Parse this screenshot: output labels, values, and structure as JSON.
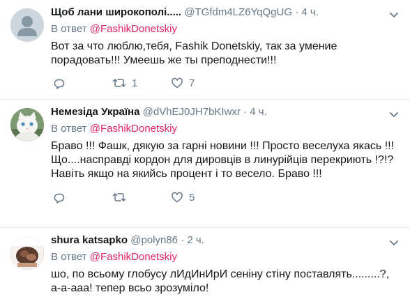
{
  "tweets": [
    {
      "name": "Щоб лани широкополі.....",
      "handle": "@TGfdm4LZ6YqQgUG",
      "sep": "·",
      "time": "4 ч.",
      "reply_prefix": "В ответ",
      "reply_mention": "@FashikDonetskiy",
      "text": "Вот за что люблю,тебя, Fashik Donetskiy, так за умение порадовать!!! Умеешь же ты  преподнести!!!",
      "retweets": "1",
      "likes": "7",
      "avatar": "default-avatar"
    },
    {
      "name": "Немезіда Україна",
      "handle": "@dVhEJ0JH7bKIwxr",
      "sep": "·",
      "time": "4 ч.",
      "reply_prefix": "В ответ",
      "reply_mention": "@FashikDonetskiy",
      "text": "Браво !!! Фашк, дякую за гарні новини !!! Просто веселуха якась !!! Що....насправді кордон для дировців в линурійців перекриють !?!? Навіть якщо на якийсь процент і то весело. Браво !!!",
      "retweets": "",
      "likes": "5",
      "avatar": "white-cat-avatar"
    },
    {
      "name": "shura katsapko",
      "handle": "@polyn86",
      "sep": "·",
      "time": "2 ч.",
      "reply_prefix": "В ответ",
      "reply_mention": "@FashikDonetskiy",
      "text": "шо, по всьому глобусу лИдИнИрИ сеніну стіну поставлять.........?, а-а-ааа! тепер всьо зрозуміло!",
      "avatar": "photo-avatar"
    }
  ],
  "colors": {
    "mention": "#e0245e",
    "secondary": "#657786",
    "text": "#14171a",
    "divider": "#e6ecf0"
  }
}
